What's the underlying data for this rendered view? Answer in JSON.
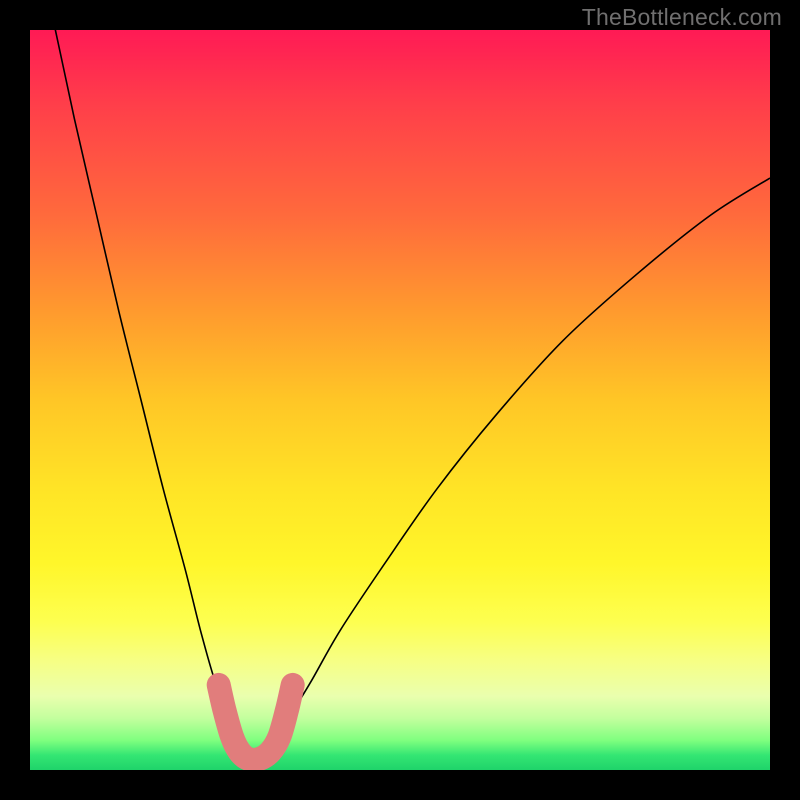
{
  "watermark": {
    "text": "TheBottleneck.com"
  },
  "chart_data": {
    "type": "line",
    "title": "",
    "xlabel": "",
    "ylabel": "",
    "xlim": [
      0,
      100
    ],
    "ylim": [
      0,
      100
    ],
    "grid": false,
    "legend": false,
    "background_gradient": {
      "direction": "vertical",
      "stops": [
        {
          "value": 100,
          "color": "#ff1a55"
        },
        {
          "value": 50,
          "color": "#ffe426"
        },
        {
          "value": 0,
          "color": "#1fd36a"
        }
      ],
      "meaning": "curve height = bottleneck percentage (red high, green low)"
    },
    "series": [
      {
        "name": "bottleneck-curve",
        "stroke": "#000000",
        "stroke_width": 1.4,
        "x": [
          0,
          3,
          6,
          9,
          12,
          15,
          18,
          21,
          23,
          25,
          27,
          29,
          30,
          31,
          33,
          35,
          38,
          42,
          48,
          55,
          63,
          72,
          82,
          92,
          100
        ],
        "y": [
          115,
          102,
          88,
          75,
          62,
          50,
          38,
          27,
          19,
          12,
          7,
          3,
          1.5,
          1.5,
          3,
          7,
          12,
          19,
          28,
          38,
          48,
          58,
          67,
          75,
          80
        ]
      },
      {
        "name": "highlight-segment",
        "stroke": "#e17d7c",
        "stroke_width": 12,
        "linecap": "round",
        "x": [
          25.5,
          26.3,
          27.3,
          28.3,
          29.5,
          31.0,
          32.5,
          33.7,
          34.7,
          35.5
        ],
        "y": [
          11.5,
          8.0,
          4.5,
          2.5,
          1.5,
          1.5,
          2.5,
          4.5,
          8.0,
          11.5
        ]
      }
    ]
  }
}
